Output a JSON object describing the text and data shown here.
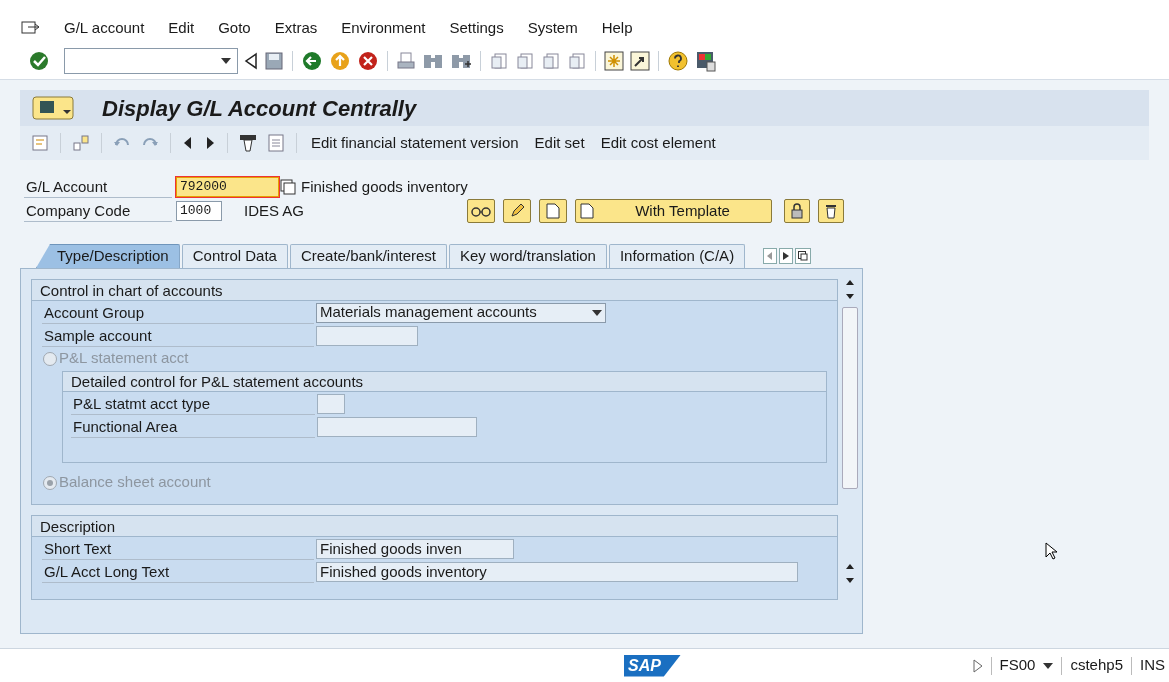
{
  "menu_bar": {
    "items": [
      "G/L account",
      "Edit",
      "Goto",
      "Extras",
      "Environment",
      "Settings",
      "System",
      "Help"
    ]
  },
  "title": "Display G/L Account Centrally",
  "app_toolbar": {
    "buttons": [
      "Edit financial statement version",
      "Edit set",
      "Edit cost element"
    ]
  },
  "header_fields": [
    {
      "label": "G/L Account",
      "value": "792000",
      "description": "Finished goods inventory",
      "focused": true
    },
    {
      "label": "Company Code",
      "value": "1000",
      "description": "IDES AG",
      "focused": false
    }
  ],
  "template_button": {
    "label": "With Template"
  },
  "tabs": [
    {
      "label": "Type/Description",
      "selected": true
    },
    {
      "label": "Control Data",
      "selected": false
    },
    {
      "label": "Create/bank/interest",
      "selected": false
    },
    {
      "label": "Key word/translation",
      "selected": false
    },
    {
      "label": "Information (C/A)",
      "selected": false
    }
  ],
  "groups": [
    {
      "title": "Control in chart of accounts",
      "rows": [
        {
          "kind": "dropdown",
          "label": "Account Group",
          "value": "Materials management accounts"
        },
        {
          "kind": "field",
          "label": "Sample account"
        },
        {
          "kind": "radio",
          "label": "P&L statement acct",
          "selected": false,
          "disabled": true
        },
        {
          "kind": "subgroup",
          "title": "Detailed control for P&L statement accounts",
          "rows": [
            {
              "kind": "field",
              "label": "P&L statmt acct type"
            },
            {
              "kind": "field",
              "label": "Functional Area"
            }
          ]
        },
        {
          "kind": "radio",
          "label": "Balance sheet account",
          "selected": true,
          "disabled": true
        }
      ]
    },
    {
      "title": "Description",
      "rows": [
        {
          "kind": "field",
          "label": "Short Text",
          "value": "Finished goods inven"
        },
        {
          "kind": "field",
          "label": "G/L Acct Long Text",
          "value": "Finished goods inventory"
        }
      ]
    }
  ],
  "status_bar": {
    "logo": "SAP",
    "transaction": "FS00",
    "server": "cstehp5",
    "mode": "INS"
  }
}
